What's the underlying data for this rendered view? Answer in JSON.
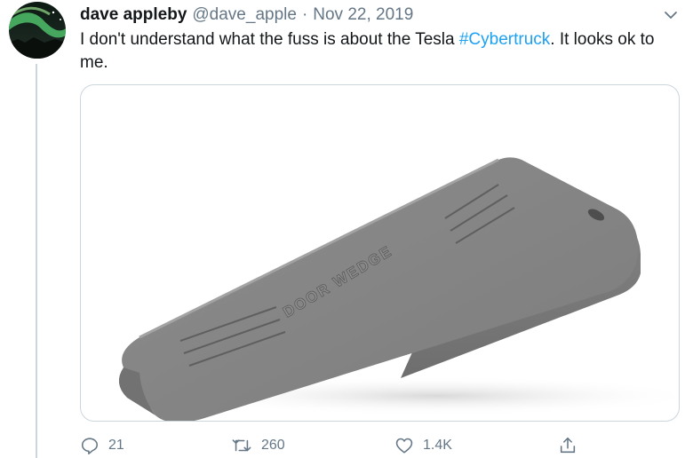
{
  "tweet": {
    "author_name": "dave appleby",
    "author_handle": "@dave_apple",
    "separator": "·",
    "date": "Nov 22, 2019",
    "text_before": "I don't understand what the fuss is about the Tesla ",
    "hashtag": "#Cybertruck",
    "text_after": ". It looks ok to me.",
    "media": {
      "embossed_text": "DOOR WEDGE"
    }
  },
  "actions": {
    "reply_count": "21",
    "retweet_count": "260",
    "like_count": "1.4K"
  },
  "colors": {
    "link": "#1da1f2",
    "secondary_text": "#657786",
    "border": "#ccd6dd"
  },
  "icons": [
    "avatar-aurora",
    "chevron-down-icon",
    "reply-icon",
    "retweet-icon",
    "like-icon",
    "share-icon"
  ]
}
